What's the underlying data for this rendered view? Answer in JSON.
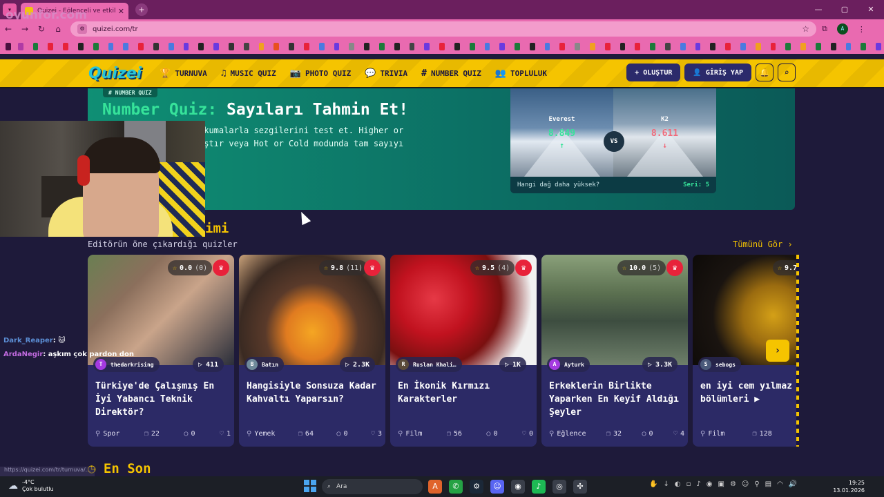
{
  "browser": {
    "tab_title": "Quizei - Eğlenceli ve etkileşimli...",
    "tab_close": "✕",
    "new_tab": "+",
    "url": "quizei.com/tr",
    "window_controls": [
      "—",
      "▢",
      "✕"
    ],
    "watermark": "oyunfor.com"
  },
  "header": {
    "logo": "Quizei",
    "nav": [
      {
        "icon": "trophy-icon",
        "glyph": "🏆",
        "label": "TURNUVA"
      },
      {
        "icon": "music-icon",
        "glyph": "♫",
        "label": "MUSIC QUIZ"
      },
      {
        "icon": "camera-icon",
        "glyph": "📷",
        "label": "PHOTO QUIZ"
      },
      {
        "icon": "chat-icon",
        "glyph": "💬",
        "label": "TRIVIA"
      },
      {
        "icon": "hash-icon",
        "glyph": "#",
        "label": "NUMBER QUIZ"
      },
      {
        "icon": "users-icon",
        "glyph": "👥",
        "label": "TOPLULUK"
      }
    ],
    "create_label": "+ OLUŞTUR",
    "login_label": "GİRİŞ YAP"
  },
  "hero": {
    "tag": "# NUMBER QUIZ",
    "title_highlight": "Number Quiz:",
    "title_rest": " Sayıları Tahmin Et!",
    "desc_line1": "okumalarla sezgilerini test et. Higher or",
    "desc_line2": "aştır veya Hot or Cold modunda tam sayıyı",
    "vs_card": {
      "left_name": "Everest",
      "left_value": "8.849",
      "left_arrow": "↑",
      "right_name": "K2",
      "right_value": "8.611",
      "right_arrow": "↓",
      "vs": "VS",
      "question": "Hangi dağ daha yüksek?",
      "streak": "Seri: 5",
      "colors": {
        "up": "#36e39a",
        "down": "#f06a7a"
      }
    }
  },
  "featured": {
    "title_fragment": "imi",
    "subtitle": "Editörün öne çıkardığı quizler",
    "see_all": "Tümünü Gör ›",
    "cards": [
      {
        "rating": "0.0",
        "count": "(0)",
        "author": "thedarkrising",
        "author_initial": "T",
        "plays": "411",
        "title": "Türkiye'de Çalışmış En İyi Yabancı Teknik Direktör?",
        "category": "Spor",
        "questions": "22",
        "comments": "0",
        "likes": "1"
      },
      {
        "rating": "9.8",
        "count": "(11)",
        "author": "Batın",
        "author_initial": "B",
        "plays": "2.3K",
        "title": "Hangisiyle Sonsuza Kadar Kahvaltı Yaparsın?",
        "category": "Yemek",
        "questions": "64",
        "comments": "0",
        "likes": "3"
      },
      {
        "rating": "9.5",
        "count": "(4)",
        "author": "Ruslan Khali…",
        "author_initial": "R",
        "plays": "1K",
        "title": "En İkonik Kırmızı Karakterler",
        "category": "Film",
        "questions": "56",
        "comments": "0",
        "likes": "0"
      },
      {
        "rating": "10.0",
        "count": "(5)",
        "author": "Ayturk",
        "author_initial": "A",
        "plays": "3.3K",
        "title": "Erkeklerin Birlikte Yaparken En Keyif Aldığı Şeyler",
        "category": "Eğlence",
        "questions": "32",
        "comments": "0",
        "likes": "4"
      },
      {
        "rating": "9.7",
        "count": "",
        "author": "sebogs",
        "author_initial": "S",
        "plays": "",
        "title": "en iyi cem yılmaz up bölümleri ▶",
        "category": "Film",
        "questions": "128",
        "comments": "",
        "likes": ""
      }
    ],
    "next": "›"
  },
  "latest": {
    "title": "En Son"
  },
  "chat": [
    {
      "user": "Dark_Reaper",
      "msg": ": 🐱"
    },
    {
      "user": "ArdaNegir",
      "msg": ": aşkım çok pardon don"
    }
  ],
  "status_url": "https://quizei.com/tr/turnuva/...",
  "taskbar": {
    "temp": "-4°C",
    "weather": "Çok bulutlu",
    "search": "Ara",
    "time": "19:25",
    "date": "13.01.2026"
  }
}
